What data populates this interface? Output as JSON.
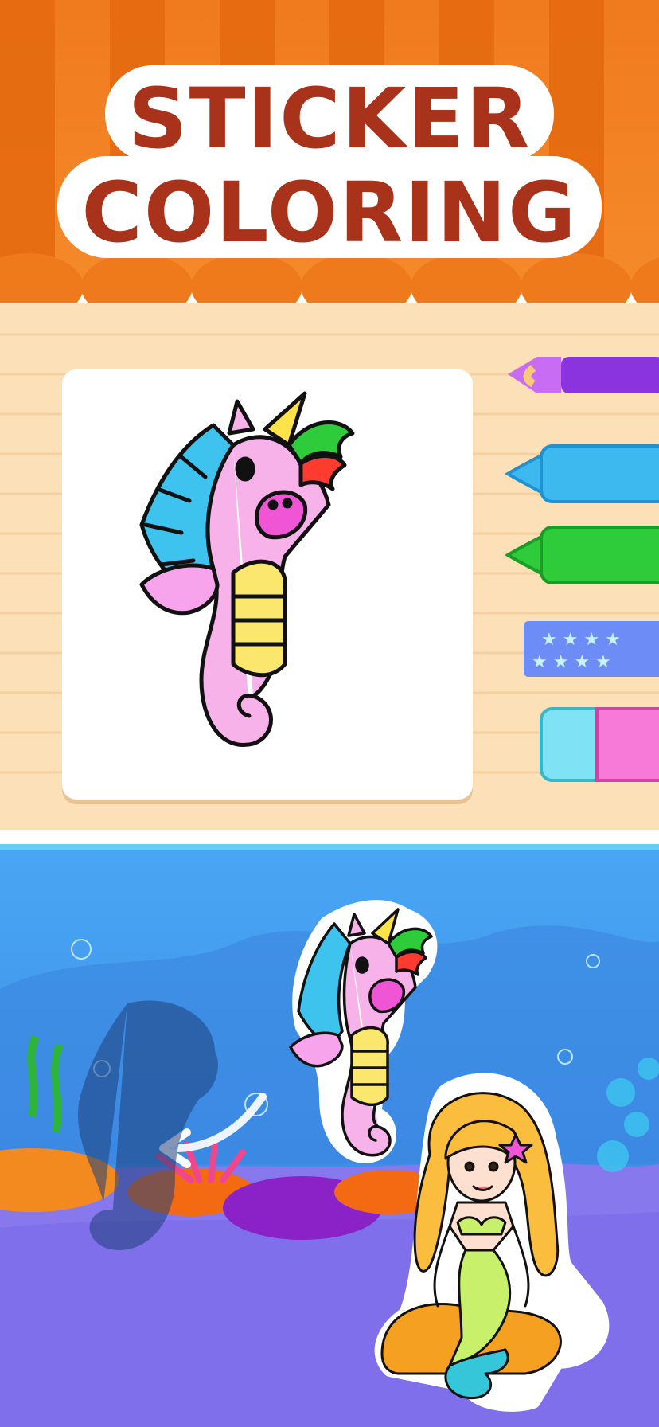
{
  "title": {
    "line1": "STICKER",
    "line2": "COLORING"
  },
  "colors": {
    "awning_orange": "#f07a1e",
    "awning_dark": "#e0620f",
    "title_text": "#a8321a",
    "paper": "#fbe0b8",
    "sea_top": "#4aa8f5",
    "sea_bottom": "#8c7ef0",
    "seahorse_pink": "#f7b3e9",
    "fin_blue": "#3ec3ef",
    "belly_yellow": "#fbe66e"
  },
  "tools": [
    {
      "name": "brush",
      "color": "#a54df0",
      "icon": "paint-brush-icon"
    },
    {
      "name": "marker-blue",
      "color": "#3db9f0",
      "icon": "marker-icon"
    },
    {
      "name": "marker-green",
      "color": "#2ecb3a",
      "icon": "marker-icon"
    },
    {
      "name": "glitter-tape",
      "color": "#6e8cf5",
      "icon": "star-pattern-icon"
    },
    {
      "name": "eraser",
      "color": "#f77ad9",
      "icon": "eraser-icon"
    }
  ],
  "scene": {
    "stickers": [
      "unicorn-seahorse",
      "mermaid"
    ],
    "silhouette": "seahorse-shadow",
    "drag_hint": "arrow-left-icon"
  }
}
